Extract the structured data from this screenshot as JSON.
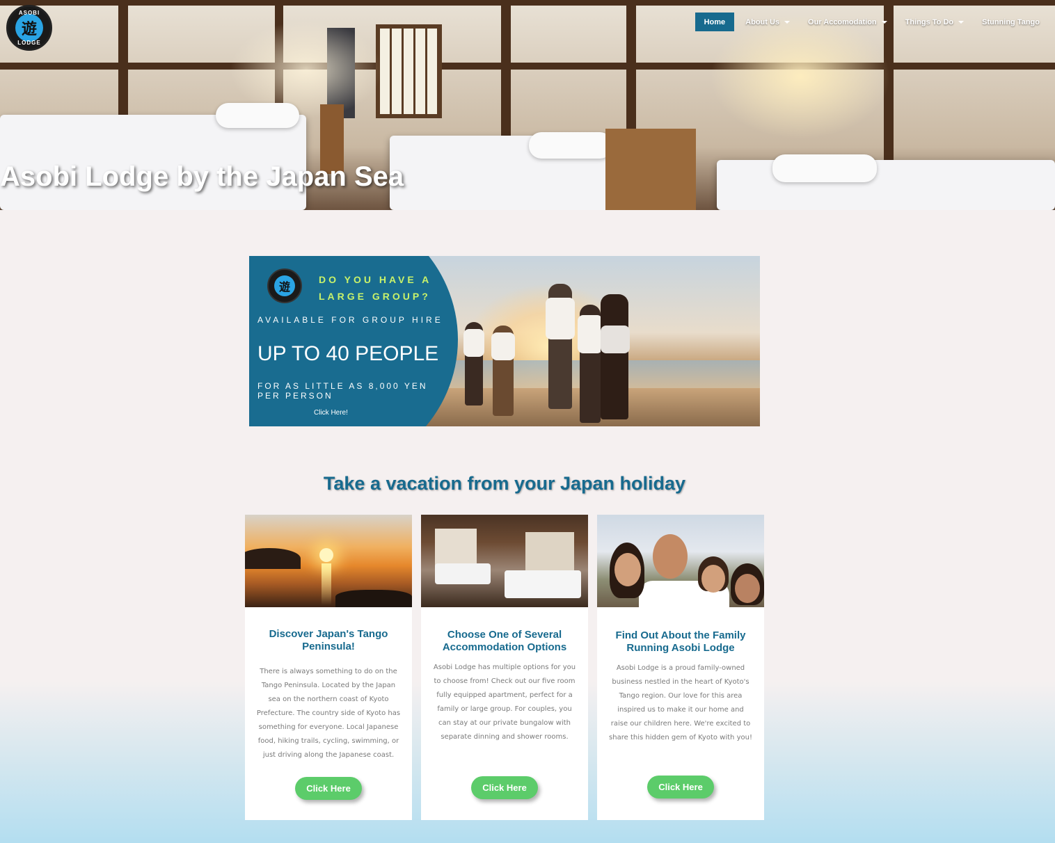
{
  "site": {
    "logo_top": "ASOBI",
    "logo_char": "遊",
    "logo_bottom": "LODGE"
  },
  "nav": {
    "items": [
      {
        "label": "Home",
        "active": true,
        "dropdown": false
      },
      {
        "label": "About Us",
        "active": false,
        "dropdown": true
      },
      {
        "label": "Our Accomodation",
        "active": false,
        "dropdown": true
      },
      {
        "label": "Things To Do",
        "active": false,
        "dropdown": true
      },
      {
        "label": "Stunning Tango",
        "active": false,
        "dropdown": false
      }
    ]
  },
  "hero": {
    "title": "Asobi Lodge by the Japan Sea"
  },
  "banner": {
    "question": "DO YOU HAVE A LARGE GROUP?",
    "availability": "AVAILABLE FOR GROUP HIRE",
    "capacity": "UP TO 40 PEOPLE",
    "price": "FOR AS LITTLE AS 8,000 YEN PER PERSON",
    "cta": "Click Here!"
  },
  "section": {
    "heading": "Take a vacation from your Japan holiday"
  },
  "cards": [
    {
      "title": "Discover Japan's Tango Peninsula!",
      "body": "There is always something to do on the Tango Peninsula. Located by the Japan sea on the northern coast of Kyoto Prefecture. The country side of Kyoto has something for everyone. Local Japanese food, hiking trails, cycling, swimming, or just driving along the Japanese coast.",
      "button": "Click Here"
    },
    {
      "title": "Choose One of Several Accommodation Options",
      "body": "Asobi Lodge has multiple options for you to choose from! Check out our five room fully equipped apartment, perfect for a family or large group. For couples, you can stay at our private bungalow with separate dinning and shower rooms.",
      "button": "Click Here"
    },
    {
      "title": "Find Out About the Family Running Asobi Lodge",
      "body": "Asobi Lodge is a proud family-owned business nestled in the heart of Kyoto's Tango region. Our love for this area inspired us to make it our home and raise our children here. We're excited to share this hidden gem of Kyoto with you!",
      "button": "Click Here"
    }
  ],
  "colors": {
    "brand_blue": "#176a8e",
    "button_green": "#5ccc6a",
    "banner_accent": "#c8f26a"
  }
}
